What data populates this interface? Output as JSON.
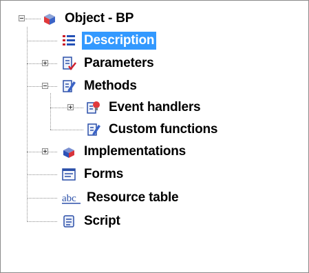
{
  "tree": {
    "root": {
      "label": "Object - BP",
      "icon": "cube-icon",
      "expanded": true
    },
    "items": [
      {
        "label": "Description",
        "icon": "list-icon",
        "selected": true
      },
      {
        "label": "Parameters",
        "icon": "document-check-icon",
        "expanded": false
      },
      {
        "label": "Methods",
        "icon": "document-pencil-icon",
        "expanded": true,
        "children": [
          {
            "label": "Event handlers",
            "icon": "document-bulb-icon",
            "expanded": false
          },
          {
            "label": "Custom functions",
            "icon": "document-pencil-icon"
          }
        ]
      },
      {
        "label": "Implementations",
        "icon": "cube-icon",
        "expanded": false
      },
      {
        "label": "Forms",
        "icon": "form-icon"
      },
      {
        "label": "Resource table",
        "icon": "abc-icon"
      },
      {
        "label": "Script",
        "icon": "scroll-icon"
      }
    ]
  },
  "colors": {
    "selection": "#3399ff",
    "connector": "#8c8c8c"
  }
}
